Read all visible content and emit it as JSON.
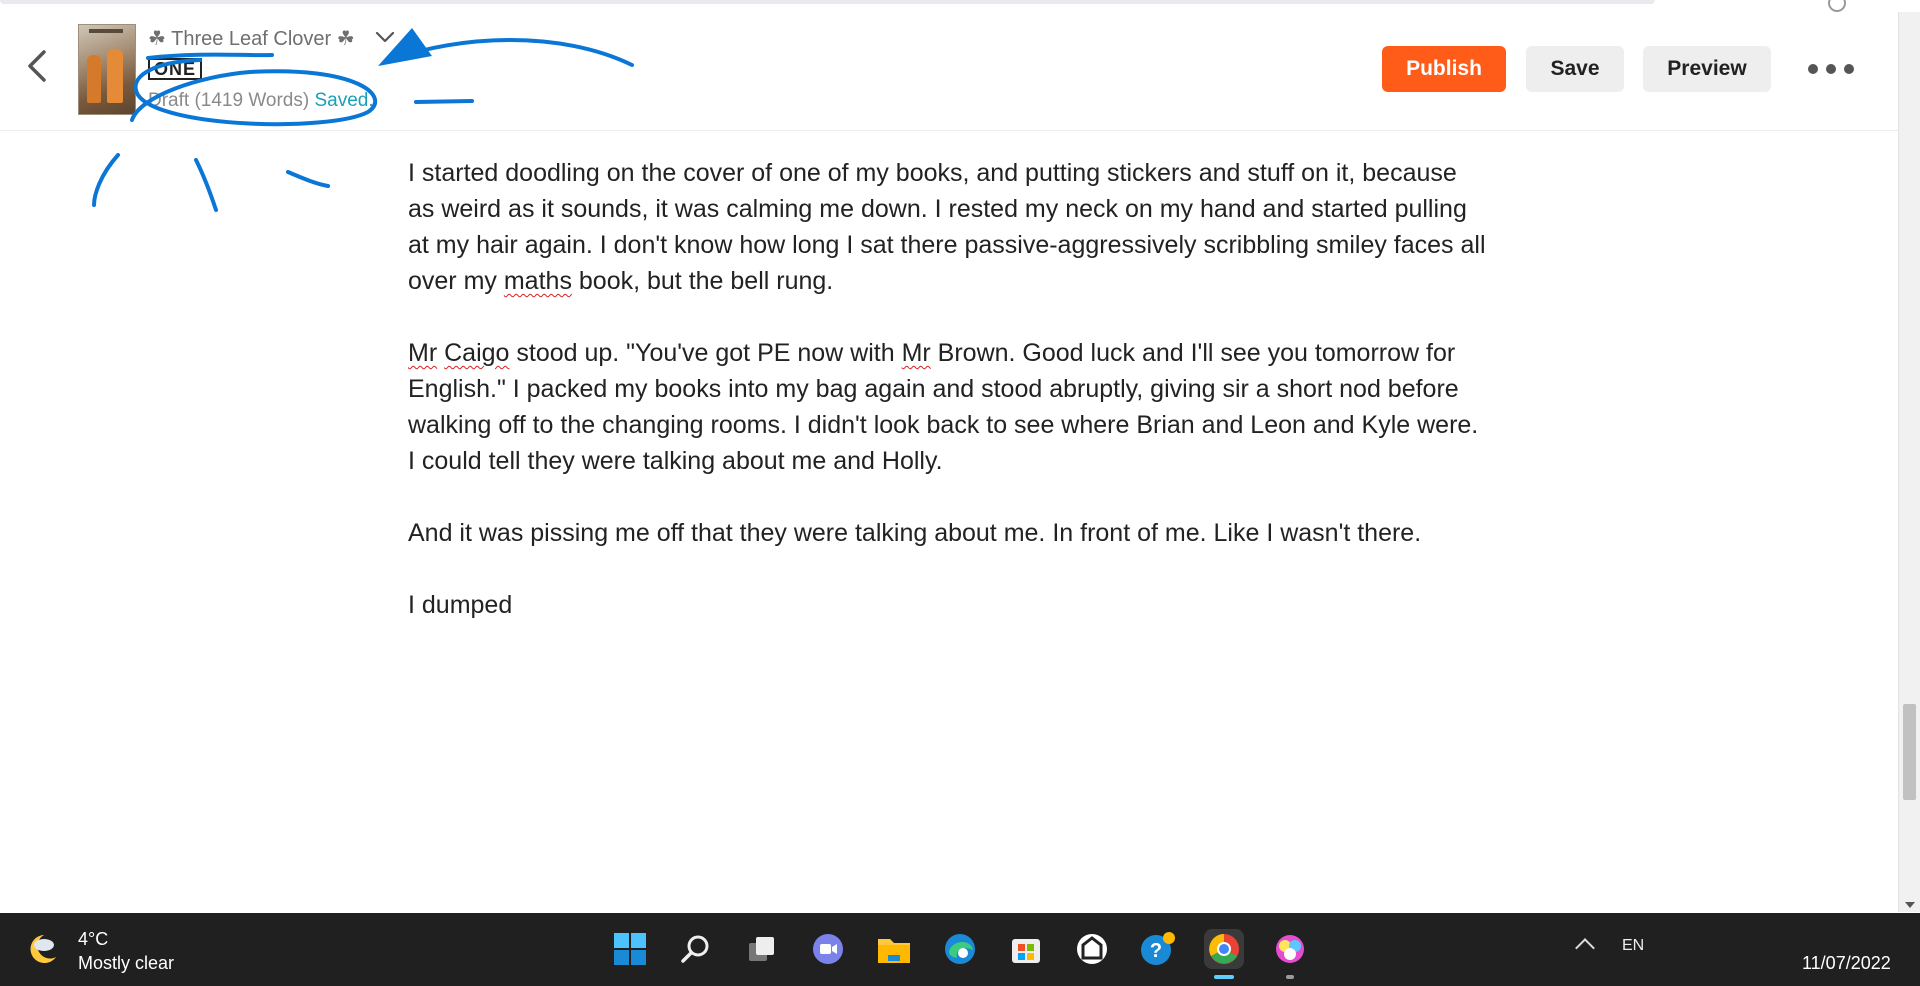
{
  "header": {
    "story_title": "☘ Three Leaf Clover ☘",
    "part_title": "ONE",
    "status_draft": "Draft (1419 Words)",
    "status_saved": "Saved.",
    "publish_label": "Publish",
    "save_label": "Save",
    "preview_label": "Preview"
  },
  "editor": {
    "p1": {
      "a": "I started doodling on the cover of one of my books, and putting stickers and stuff on it, because as weird as it sounds, it was calming me down. I rested my neck on my hand and started pulling at my hair again. I don't know how long I sat there passive-aggressively scribbling smiley faces all over my ",
      "spell": "maths",
      "b": " book, but the bell rung."
    },
    "p2": {
      "s1": "Mr",
      "s2": "Caigo",
      "a": " stood up. \"You've got PE now with ",
      "s3": "Mr",
      "b": " Brown. Good luck and I'll see you tomorrow for English.\" I packed my books into my bag again and stood abruptly, giving sir a short nod before walking off to the changing rooms. I didn't look back to see where Brian and Leon and Kyle were. I could tell they were talking about me and Holly."
    },
    "p3": "And it was pissing me off that they were talking about me. In front of me. Like I wasn't there.",
    "p4": "I dumped"
  },
  "taskbar": {
    "temperature": "4°C",
    "condition": "Mostly clear",
    "tray_lang": "EN",
    "date": "11/07/2022"
  },
  "colors": {
    "publish": "#ff5c1a",
    "saved": "#1aa0b8",
    "annotation": "#0a76d6",
    "taskbar": "#202020"
  }
}
